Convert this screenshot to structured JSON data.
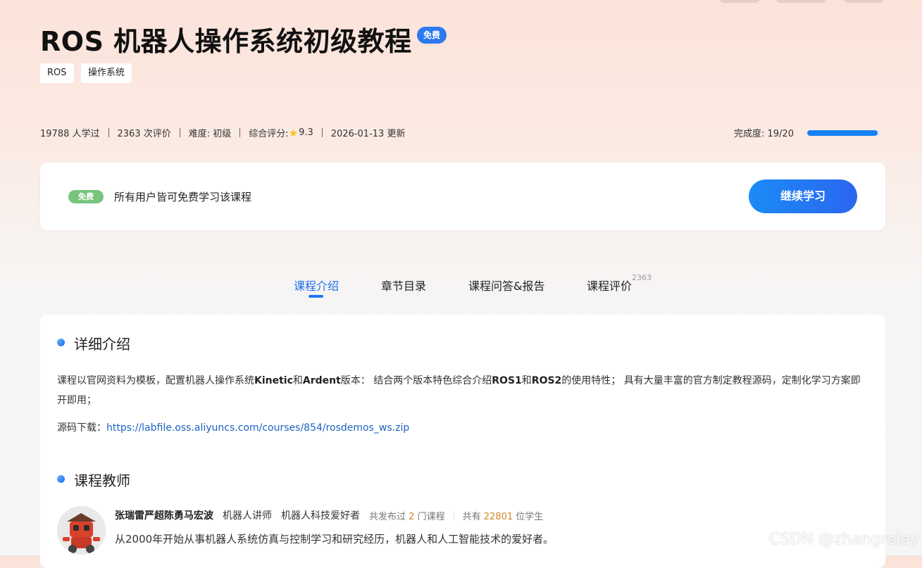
{
  "course": {
    "title": "ROS 机器人操作系统初级教程",
    "badge": "免费",
    "tags": [
      "ROS",
      "操作系统"
    ]
  },
  "stats": {
    "learners": "19788 人学过",
    "reviews": "2363 次评价",
    "difficulty": "难度: 初级",
    "rating_label": "综合评分:",
    "rating_value": "9.3",
    "updated": "2026-01-13 更新"
  },
  "progress": {
    "label": "完成度: 19/20",
    "fraction": 0.95
  },
  "free_card": {
    "pill": "免费",
    "text": "所有用户皆可免费学习该课程",
    "button": "继续学习"
  },
  "tabs": [
    {
      "label": "课程介绍",
      "active": true
    },
    {
      "label": "章节目录"
    },
    {
      "label": "课程问答&报告"
    },
    {
      "label": "课程评价",
      "count": "2363"
    }
  ],
  "intro": {
    "heading": "详细介绍",
    "p1": "课程以官网资料为模板，配置机器人操作系统",
    "kinetic": "Kinetic",
    "p2": "和",
    "ardent": "Ardent",
    "p3": "版本： 结合两个版本特色综合介绍",
    "ros1": "ROS1",
    "p4": "和",
    "ros2": "ROS2",
    "p5": "的使用特性； 具有大量丰富的官方制定教程源码，定制化学习方案即开即用；",
    "source_label": "源码下载：",
    "source_url": "https://labfile.oss.aliyuncs.com/courses/854/rosdemos_ws.zip"
  },
  "teacher": {
    "heading": "课程教师",
    "name": "张瑞雷严超陈勇马宏波",
    "role1": "机器人讲师",
    "role2": "机器人科技爱好者",
    "courses_prefix": "共发布过",
    "courses_count": "2",
    "courses_suffix": "门课程",
    "students_prefix": "共有",
    "students_count": "22801",
    "students_suffix": "位学生",
    "bio": "从2000年开始从事机器人系统仿真与控制学习和研究经历，机器人和人工智能技术的爱好者。"
  },
  "watermark": "CSDN @zhangrelay"
}
